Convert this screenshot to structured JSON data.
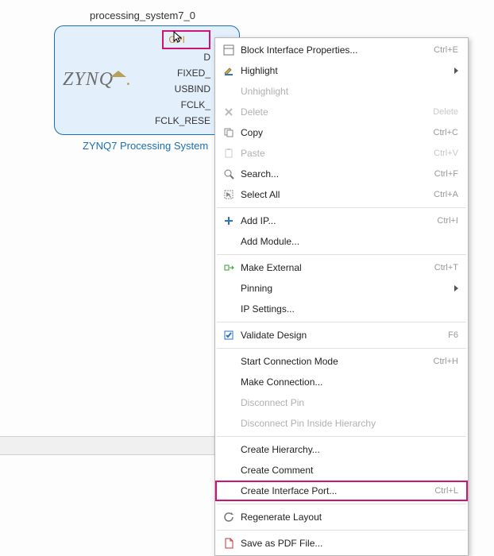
{
  "block": {
    "instance_name": "processing_system7_0",
    "caption": "ZYNQ7 Processing System",
    "logo_text": "ZYNQ",
    "ports": {
      "p0": "GPI",
      "p1": "D",
      "p2": "FIXED_",
      "p3": "USBIND",
      "p4": "FCLK_",
      "p5": "FCLK_RESE"
    }
  },
  "menu": {
    "block_if_props": {
      "label": "Block Interface Properties...",
      "shortcut": "Ctrl+E"
    },
    "highlight": {
      "label": "Highlight"
    },
    "unhighlight": {
      "label": "Unhighlight"
    },
    "delete": {
      "label": "Delete",
      "shortcut": "Delete"
    },
    "copy": {
      "label": "Copy",
      "shortcut": "Ctrl+C"
    },
    "paste": {
      "label": "Paste",
      "shortcut": "Ctrl+V"
    },
    "search": {
      "label": "Search...",
      "shortcut": "Ctrl+F"
    },
    "select_all": {
      "label": "Select All",
      "shortcut": "Ctrl+A"
    },
    "add_ip": {
      "label": "Add IP...",
      "shortcut": "Ctrl+I"
    },
    "add_module": {
      "label": "Add Module..."
    },
    "make_external": {
      "label": "Make External",
      "shortcut": "Ctrl+T"
    },
    "pinning": {
      "label": "Pinning"
    },
    "ip_settings": {
      "label": "IP Settings..."
    },
    "validate": {
      "label": "Validate Design",
      "shortcut": "F6"
    },
    "start_conn": {
      "label": "Start Connection Mode",
      "shortcut": "Ctrl+H"
    },
    "make_conn": {
      "label": "Make Connection..."
    },
    "disc_pin": {
      "label": "Disconnect Pin"
    },
    "disc_hier": {
      "label": "Disconnect Pin Inside Hierarchy"
    },
    "create_hier": {
      "label": "Create Hierarchy..."
    },
    "create_comment": {
      "label": "Create Comment"
    },
    "create_if_port": {
      "label": "Create Interface Port...",
      "shortcut": "Ctrl+L"
    },
    "regen": {
      "label": "Regenerate Layout"
    },
    "save_pdf": {
      "label": "Save as PDF File..."
    }
  }
}
